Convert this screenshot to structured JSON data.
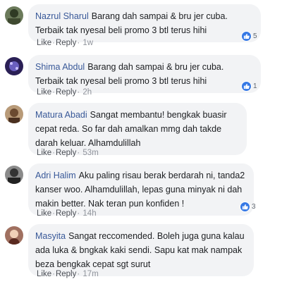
{
  "comments": [
    {
      "author": "Nazrul Sharul",
      "text": "Barang dah sampai & bru jer cuba. Terbaik tak nyesal beli promo 3 btl terus hihi",
      "like_label": "Like",
      "reply_label": "Reply",
      "time": "1w",
      "reactions": "5",
      "avatar_color": "#4a5a3a"
    },
    {
      "author": "Shima Abdul",
      "text": "Barang dah sampai & bru jer cuba. Terbaik tak nyesal beli promo 3 btl terus hihi",
      "like_label": "Like",
      "reply_label": "Reply",
      "time": "2h",
      "reactions": "1",
      "avatar_color": "#3b2a6e"
    },
    {
      "author": "Matura Abadi",
      "text": "Sangat membantu! bengkak buasir cepat reda. So far dah amalkan mmg dah takde darah keluar. Alhamdulillah",
      "like_label": "Like",
      "reply_label": "Reply",
      "time": "53m",
      "reactions": "",
      "avatar_color": "#8a6a4a"
    },
    {
      "author": "Adri Halim",
      "text": "Aku paling risau berak berdarah ni, tanda2 kanser woo. Alhamdulillah, lepas guna minyak ni dah makin better. Nak teran pun konfiden !",
      "like_label": "Like",
      "reply_label": "Reply",
      "time": "14h",
      "reactions": "3",
      "avatar_color": "#5a5a5a"
    },
    {
      "author": "Masyita",
      "text": "Sangat reccomended. Boleh juga guna kalau ada luka & bngkak kaki sendi. Sapu kat mak nampak beza bengkak cepat sgt surut",
      "like_label": "Like",
      "reply_label": "Reply",
      "time": "17m",
      "reactions": "",
      "avatar_color": "#7a4a3a"
    }
  ],
  "icons": {
    "like": "thumbs-up-icon"
  },
  "colors": {
    "author_link": "#385898",
    "bubble_bg": "#f2f3f5",
    "like_blue": "#3578e5"
  }
}
